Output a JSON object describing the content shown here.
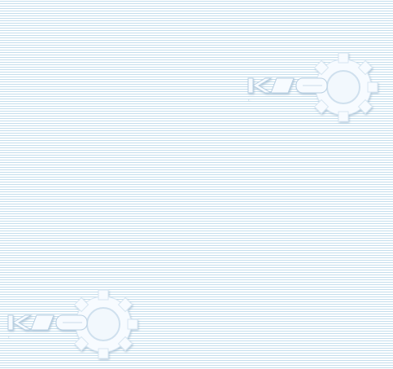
{
  "wallpaper": {
    "logo_text": "KDE",
    "colors": {
      "stripe": "#c4deed",
      "background": "#ffffff",
      "logo_fill": "#f7fbff",
      "logo_shadow": "#b8cfe2"
    }
  }
}
